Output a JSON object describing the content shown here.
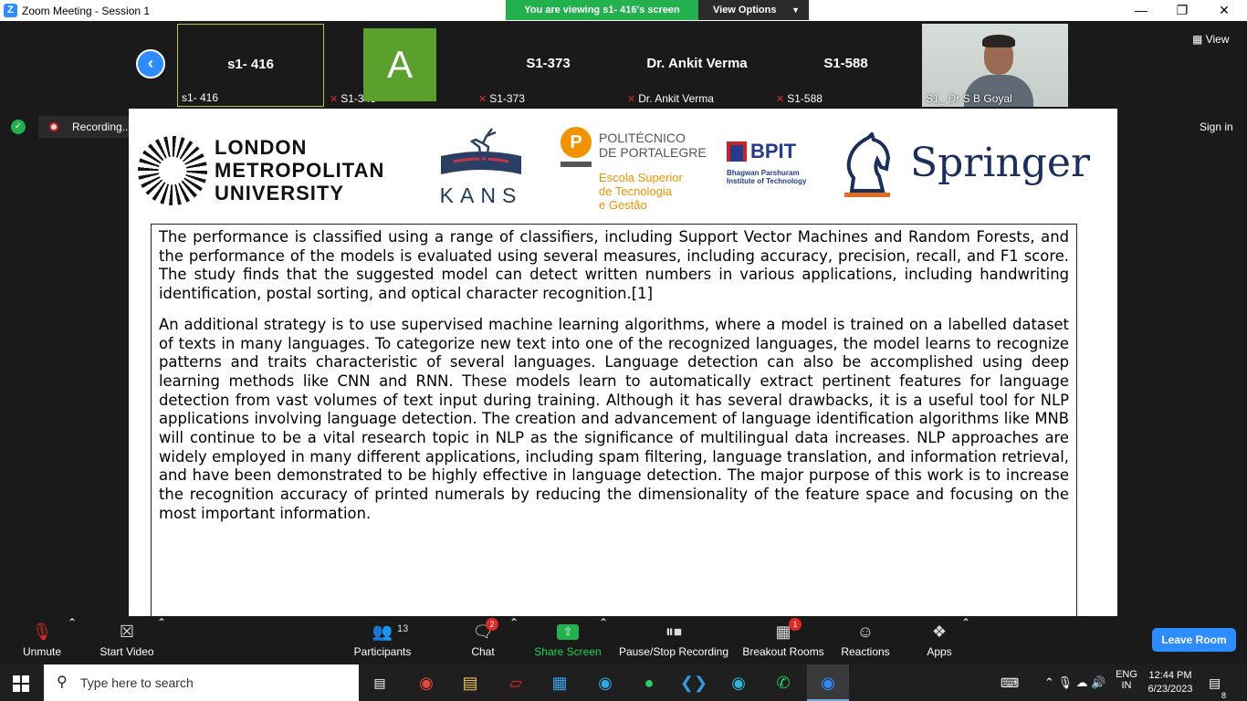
{
  "window": {
    "app_logo": "Z",
    "title": "Zoom Meeting - Session 1",
    "minimize": "—",
    "maximize": "❐",
    "close": "✕"
  },
  "share_bar": {
    "viewing_text": "You are viewing s1- 416's screen",
    "view_options": "View Options",
    "accent_color": "#22b14c"
  },
  "participants_strip": {
    "tiles": [
      {
        "name": "s1- 416",
        "label": "s1- 416",
        "muted": false
      },
      {
        "avatar_letter": "A",
        "label": "S1-343",
        "muted": true
      },
      {
        "name": "S1-373",
        "label": "S1-373",
        "muted": true
      },
      {
        "name": "Dr. Ankit Verma",
        "label": "Dr. Ankit Verma",
        "muted": true
      },
      {
        "name": "S1-588",
        "label": "S1-588",
        "muted": true
      },
      {
        "label": "S1_ Dr S B Goyal",
        "video": true
      }
    ],
    "view_label": "View"
  },
  "recording": {
    "label": "Recording...",
    "sign_in": "Sign in"
  },
  "slide": {
    "logos": {
      "lmu": [
        "LONDON",
        "METROPOLITAN",
        "UNIVERSITY"
      ],
      "kans": "KANS",
      "ipp_title": [
        "POLITÉCNICO",
        "DE PORTALEGRE"
      ],
      "ipp_school": [
        "Escola Superior",
        "de Tecnologia",
        "e Gestão"
      ],
      "bpit": "BPIT",
      "bpit_sub": [
        "Bhagwan Parshuram",
        "Institute of Technology"
      ],
      "springer": "Springer"
    },
    "paragraphs": [
      "The performance is classified using a range of classifiers, including Support Vector Machines and Random Forests, and the performance of the models is evaluated using several measures, including accuracy, precision, recall, and F1 score. The study finds that the suggested model can detect written numbers in various applications, including handwriting identification, postal sorting, and optical character recognition.[1]",
      "An additional strategy is to use supervised machine learning algorithms, where a model is trained on a labelled dataset of texts in many languages. To categorize new text into one of the recognized languages, the model learns to recognize patterns and traits characteristic of several languages. Language detection can also be accomplished using deep learning methods like CNN and RNN. These models learn to automatically extract pertinent features for language detection from vast volumes of text input during training. Although it has several drawbacks, it is a useful tool for NLP applications involving language detection. The creation and advancement of language identification algorithms like MNB will continue to be a vital research topic in NLP as the significance of multilingual data increases. NLP approaches are widely employed in many different applications, including spam filtering, language translation, and information retrieval, and have been demonstrated to be highly effective in language detection. The major purpose of this work is to increase the recognition accuracy of printed numerals by reducing the dimensionality of the feature space and focusing on the most important information."
    ]
  },
  "toolbar": {
    "unmute": "Unmute",
    "start_video": "Start Video",
    "participants": "Participants",
    "participants_count": "13",
    "chat": "Chat",
    "chat_badge": "2",
    "share_screen": "Share Screen",
    "pause_recording": "Pause/Stop Recording",
    "breakout": "Breakout Rooms",
    "breakout_badge": "1",
    "reactions": "Reactions",
    "apps": "Apps",
    "leave": "Leave Room"
  },
  "taskbar": {
    "search_placeholder": "Type here to search",
    "lang_top": "ENG",
    "lang_bottom": "IN",
    "time": "12:44 PM",
    "date": "6/23/2023",
    "notifications": "8"
  }
}
